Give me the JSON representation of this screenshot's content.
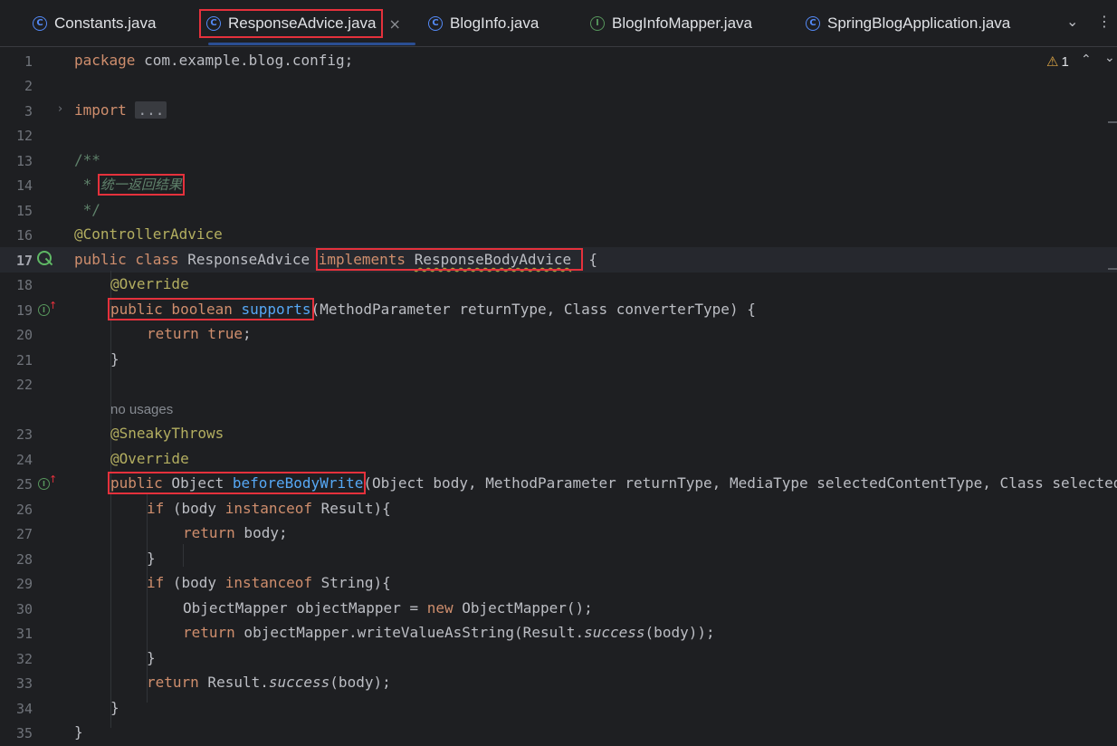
{
  "tabs": [
    {
      "label": "Constants.java",
      "icon": "C"
    },
    {
      "label": "ResponseAdvice.java",
      "icon": "C"
    },
    {
      "label": "BlogInfo.java",
      "icon": "C"
    },
    {
      "label": "BlogInfoMapper.java",
      "icon": "I"
    },
    {
      "label": "SpringBlogApplication.java",
      "icon": "C"
    }
  ],
  "tabbar": {
    "close_glyph": "×",
    "chevron": "⌄",
    "more": "⋮"
  },
  "inspections": {
    "warning_count": "1",
    "up": "⌃",
    "down": "⌄"
  },
  "line_numbers": [
    "1",
    "2",
    "3",
    "12",
    "13",
    "14",
    "15",
    "16",
    "17",
    "18",
    "19",
    "20",
    "21",
    "22",
    "23",
    "24",
    "25",
    "26",
    "27",
    "28",
    "29",
    "30",
    "31",
    "32",
    "33",
    "34",
    "35"
  ],
  "code": {
    "l1_kw": "package",
    "l1_rest": " com.example.blog.config;",
    "l3_kw": "import",
    "l3_fold": "...",
    "l13": "/**",
    "l14_star": " * ",
    "l14_text": "统一返回结果",
    "l15": " */",
    "l16": "@ControllerAdvice",
    "l17_a": "public class",
    "l17_b": " ResponseAdvice ",
    "l17_c": "implements",
    "l17_d": "ResponseBodyAdvice",
    "l17_e": " {",
    "l18": "@Override",
    "l19_kw": "public boolean",
    "l19_fn": "supports",
    "l19_rest": "(MethodParameter returnType, Class converterType) {",
    "l20_kw": "return true",
    "l20_rest": ";",
    "l21": "}",
    "no_usages": "no usages",
    "l23": "@SneakyThrows",
    "l24": "@Override",
    "l25_kw": "public",
    "l25_type": " Object ",
    "l25_fn": "beforeBodyWrite",
    "l25_rest": "(Object body, MethodParameter returnType, MediaType selectedContentType, Class selectedConverterType",
    "l26_kw": "if",
    "l26_a": " (body ",
    "l26_kw2": "instanceof",
    "l26_b": " Result){",
    "l27_kw": "return",
    "l27_rest": " body;",
    "l28": "}",
    "l29_kw": "if",
    "l29_a": " (body ",
    "l29_kw2": "instanceof",
    "l29_b": " String){",
    "l30_a": "ObjectMapper objectMapper = ",
    "l30_kw": "new",
    "l30_b": " ObjectMapper();",
    "l31_kw": "return",
    "l31_a": " objectMapper.writeValueAsString(Result.",
    "l31_it": "success",
    "l31_b": "(body));",
    "l32": "}",
    "l33_kw": "return",
    "l33_a": " Result.",
    "l33_it": "success",
    "l33_b": "(body);",
    "l34": "}",
    "l35": "}"
  }
}
